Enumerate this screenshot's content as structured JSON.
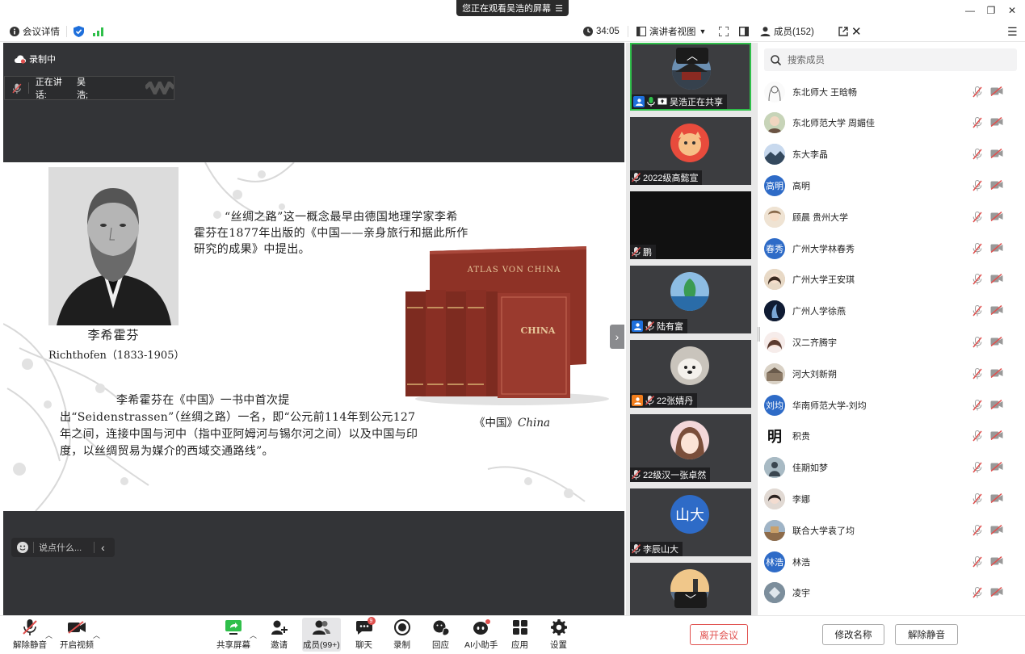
{
  "window": {
    "share_notice": "您正在观看吴浩的屏幕",
    "minimize": "—",
    "maximize": "❐",
    "close": "✕"
  },
  "toolbar": {
    "meeting_details": "会议详情",
    "timer": "34:05",
    "view_mode": "演讲者视图",
    "members_label": "成员(152)"
  },
  "stage": {
    "recording": "录制中",
    "speaking_label": "正在讲话:",
    "speaking_name": "吴浩;",
    "chat_placeholder": "说点什么..."
  },
  "slide": {
    "portrait_name_cn": "李希霍芬",
    "portrait_name_en": "Richthofen（1833-1905）",
    "para1": "“丝绸之路”这一概念最早由德国地理学家李希霍芬在1877年出版的《中国——亲身旅行和据此所作研究的成果》中提出。",
    "para2": "李希霍芬在《中国》一书中首次提出“Seidenstrassen”（丝绸之路）一名，即“公元前114年到公元127年之间，连接中国与河中（指中亚阿姆河与锡尔河之间）以及中国与印度，以丝绸贸易为媒介的西域交通路线”。",
    "book_caption_cn": "《中国》",
    "book_caption_en": "China",
    "book_title": "ATLAS VON CHINA",
    "book_cover_text": "CHINA"
  },
  "video_tiles": [
    {
      "name": "吴浩正在共享",
      "active": true
    },
    {
      "name": "2022级高懿宣"
    },
    {
      "name": "鹏"
    },
    {
      "name": "陆有富"
    },
    {
      "name": "22张婧丹"
    },
    {
      "name": "22级汉一张卓然"
    },
    {
      "name": "李辰山大",
      "avatar_text": "山大"
    }
  ],
  "members": {
    "search_placeholder": "搜索成员",
    "list": [
      {
        "name": "东北师大 王晗畅"
      },
      {
        "name": "东北师范大学 周媚佳"
      },
      {
        "name": "东大李晶"
      },
      {
        "name": "高明",
        "avatar_text": "高明"
      },
      {
        "name": "顾晨 贵州大学"
      },
      {
        "name": "广州大学林春秀",
        "avatar_text": "春秀"
      },
      {
        "name": "广州大学王安琪"
      },
      {
        "name": "广州人学徐燕"
      },
      {
        "name": "汉二齐腾宇"
      },
      {
        "name": "河大刘新朔"
      },
      {
        "name": "华南师范大学-刘均",
        "avatar_text": "刘均"
      },
      {
        "name": "积贵",
        "avatar_text": "明"
      },
      {
        "name": "佳期如梦"
      },
      {
        "name": "李娜"
      },
      {
        "name": "联合大学袁了均"
      },
      {
        "name": "林浩",
        "avatar_text": "林浩"
      },
      {
        "name": "凌宇"
      }
    ]
  },
  "bottom": {
    "unmute": "解除静音",
    "start_video": "开启视频",
    "share_screen": "共享屏幕",
    "invite": "邀请",
    "members": "成员(99+)",
    "chat": "聊天",
    "chat_badge": "9",
    "record": "录制",
    "reactions": "回应",
    "ai_assistant": "AI小助手",
    "apps": "应用",
    "settings": "设置",
    "leave": "离开会议",
    "rename": "修改名称",
    "unmute_all": "解除静音"
  },
  "colors": {
    "accent_blue": "#1e6fdb",
    "active_green": "#2fbf4a",
    "leave_red": "#e0504e",
    "stage_dark": "#333437"
  }
}
